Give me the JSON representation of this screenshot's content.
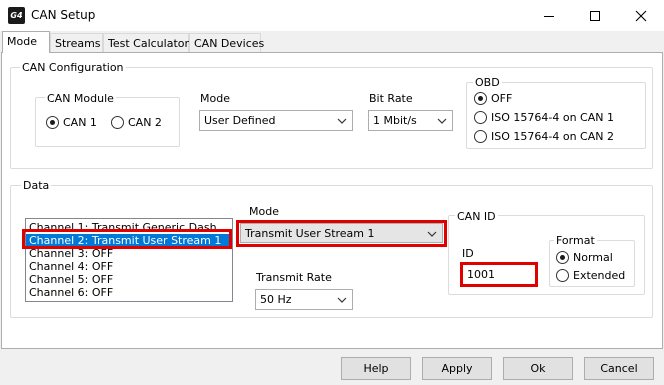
{
  "window": {
    "icon_text": "G4",
    "title": "CAN Setup"
  },
  "tabs": [
    "Mode",
    "Streams",
    "Test Calculator",
    "CAN Devices"
  ],
  "can_config": {
    "legend": "CAN Configuration",
    "module": {
      "legend": "CAN Module",
      "options": [
        "CAN 1",
        "CAN 2"
      ],
      "selected": "CAN 1"
    },
    "mode": {
      "label": "Mode",
      "value": "User Defined"
    },
    "bit_rate": {
      "label": "Bit Rate",
      "value": "1 Mbit/s"
    },
    "obd": {
      "legend": "OBD",
      "options": [
        "OFF",
        "ISO 15764-4 on CAN 1",
        "ISO 15764-4 on CAN 2"
      ],
      "selected": "OFF"
    }
  },
  "data": {
    "legend": "Data",
    "channels": [
      "Channel 1: Transmit Generic Dash",
      "Channel 2: Transmit User Stream 1",
      "Channel 3: OFF",
      "Channel 4: OFF",
      "Channel 5: OFF",
      "Channel 6: OFF"
    ],
    "selected_channel_index": 1,
    "mode": {
      "label": "Mode",
      "value": "Transmit User Stream 1"
    },
    "transmit_rate": {
      "label": "Transmit Rate",
      "value": "50 Hz"
    },
    "can_id": {
      "legend": "CAN ID",
      "id_label": "ID",
      "id_value": "1001",
      "format": {
        "legend": "Format",
        "options": [
          "Normal",
          "Extended"
        ],
        "selected": "Normal"
      }
    }
  },
  "buttons": {
    "help": "Help",
    "apply": "Apply",
    "ok": "Ok",
    "cancel": "Cancel"
  },
  "colors": {
    "highlight_red": "#e00000",
    "selection_blue": "#0078d7"
  }
}
